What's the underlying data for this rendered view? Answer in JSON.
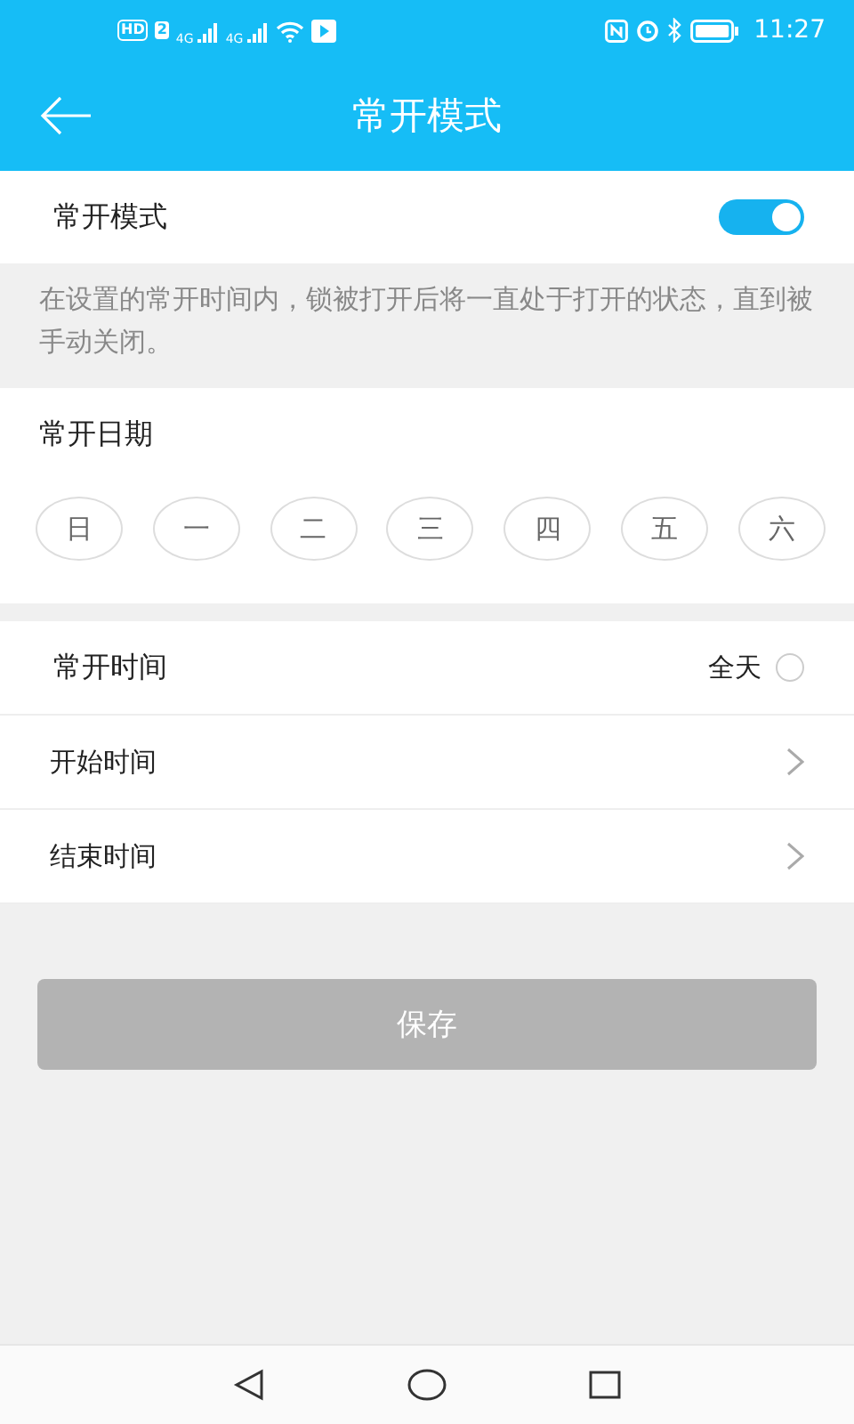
{
  "status_bar": {
    "left_badges": [
      "HD",
      "2",
      "4G",
      "4G"
    ],
    "time": "11:27"
  },
  "header": {
    "title": "常开模式"
  },
  "mode_toggle": {
    "label": "常开模式",
    "on": true
  },
  "description": "在设置的常开时间内，锁被打开后将一直处于打开的状态，直到被手动关闭。",
  "date_section": {
    "title": "常开日期",
    "days": [
      {
        "label": "日",
        "selected": false
      },
      {
        "label": "一",
        "selected": false
      },
      {
        "label": "二",
        "selected": false
      },
      {
        "label": "三",
        "selected": false
      },
      {
        "label": "四",
        "selected": false
      },
      {
        "label": "五",
        "selected": false
      },
      {
        "label": "六",
        "selected": false
      }
    ]
  },
  "time_section": {
    "title": "常开时间",
    "all_day": {
      "label": "全天",
      "checked": false
    },
    "rows": [
      {
        "label": "开始时间"
      },
      {
        "label": "结束时间"
      }
    ]
  },
  "save_button": {
    "label": "保存",
    "disabled": true
  }
}
